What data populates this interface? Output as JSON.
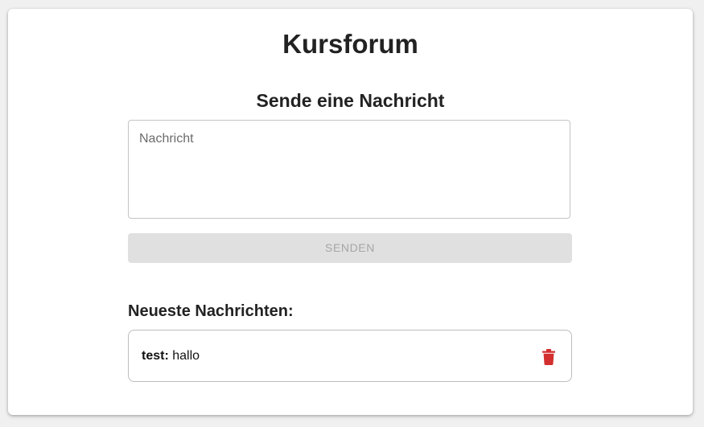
{
  "page": {
    "title": "Kursforum"
  },
  "compose": {
    "heading": "Sende eine Nachricht",
    "message_placeholder": "Nachricht",
    "message_value": "",
    "send_label": "SENDEN"
  },
  "latest": {
    "heading": "Neueste Nachrichten:",
    "messages": [
      {
        "author": "test:",
        "text": "hallo",
        "delete_icon": "trash-icon"
      }
    ]
  },
  "colors": {
    "delete_icon": "#d32f2f",
    "button_disabled_bg": "#e0e0e0",
    "button_disabled_text": "#a6a6a6"
  }
}
